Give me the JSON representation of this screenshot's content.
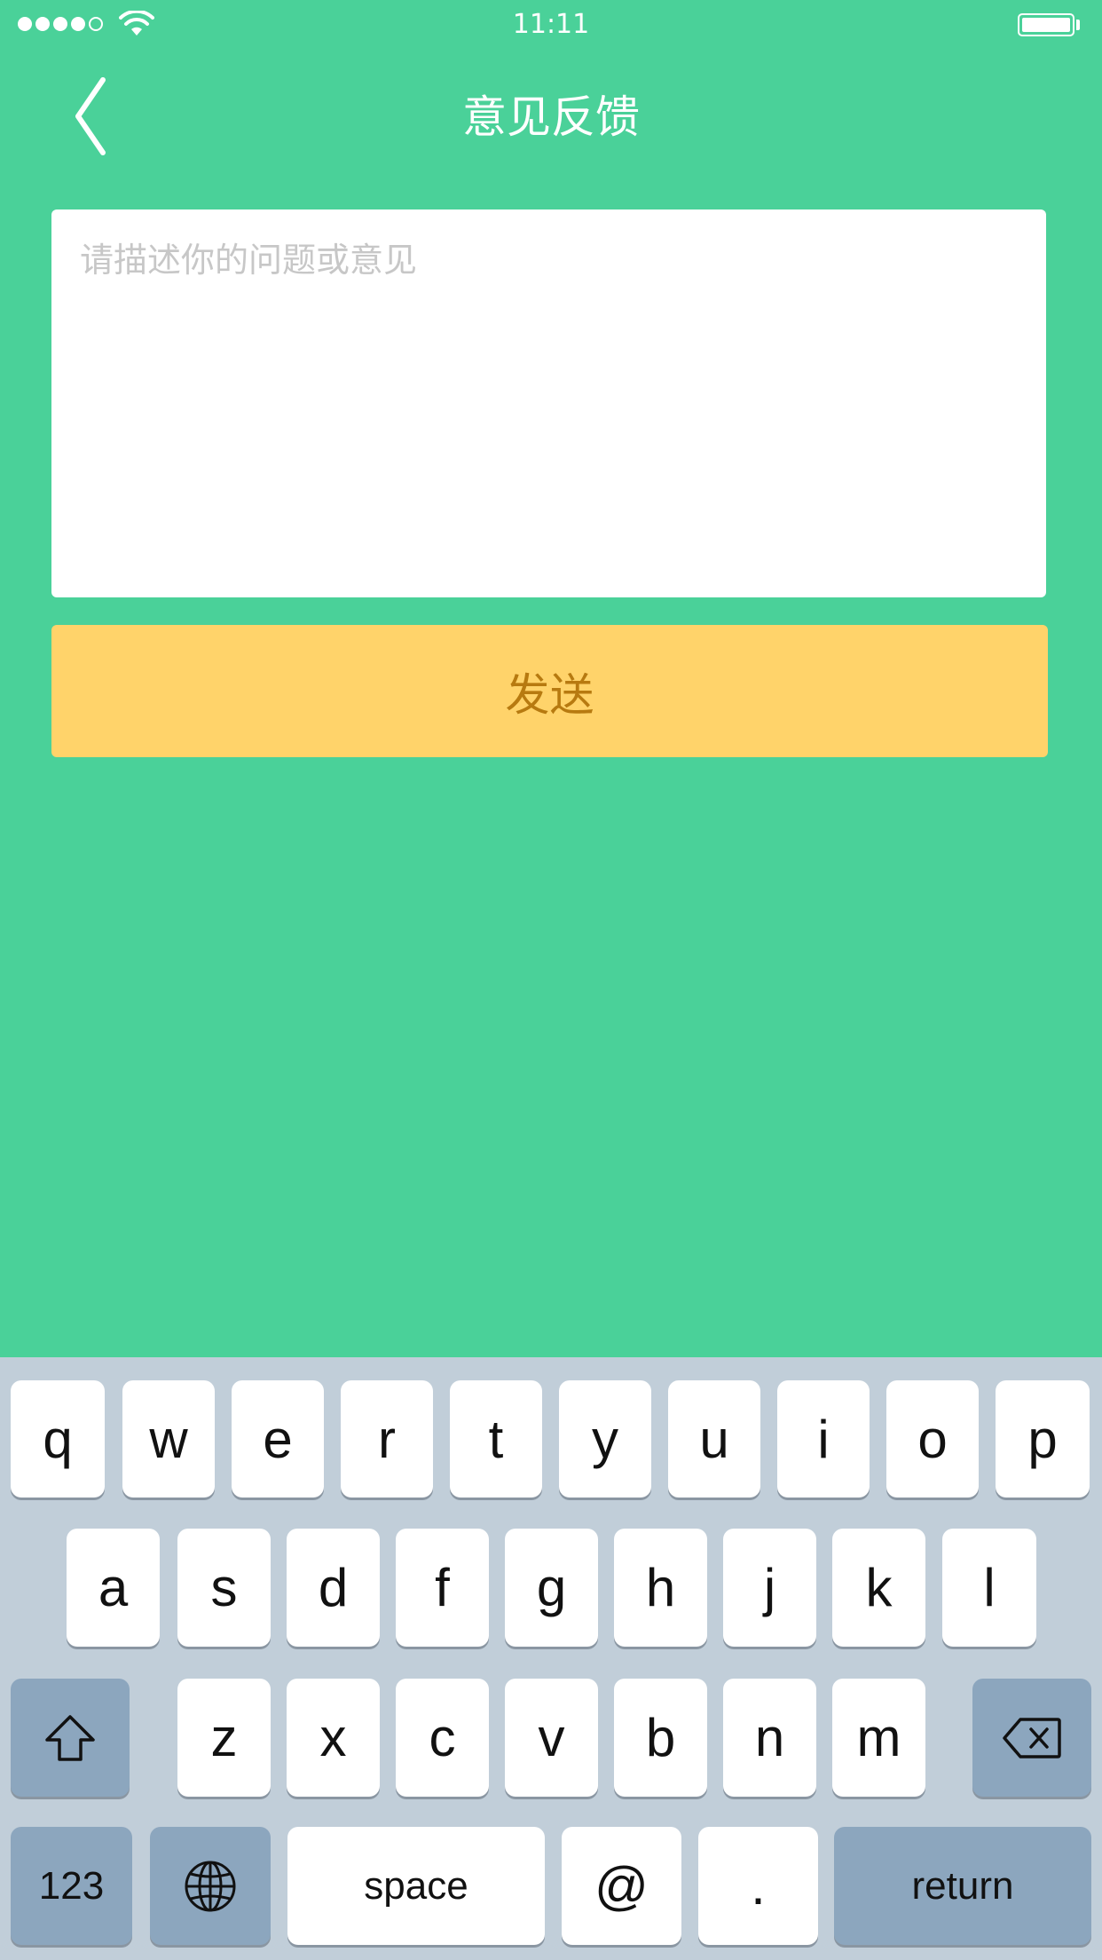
{
  "status_bar": {
    "time": "11:11"
  },
  "nav": {
    "title": "意见反馈"
  },
  "feedback": {
    "placeholder": "请描述你的问题或意见",
    "value": ""
  },
  "send_button": {
    "label": "发送"
  },
  "keyboard": {
    "row1": [
      "q",
      "w",
      "e",
      "r",
      "t",
      "y",
      "u",
      "i",
      "o",
      "p"
    ],
    "row2": [
      "a",
      "s",
      "d",
      "f",
      "g",
      "h",
      "j",
      "k",
      "l"
    ],
    "row3": [
      "z",
      "x",
      "c",
      "v",
      "b",
      "n",
      "m"
    ],
    "numbers_label": "123",
    "space_label": "space",
    "at_label": "@",
    "period_label": ".",
    "return_label": "return"
  },
  "colors": {
    "background": "#4AD199",
    "send_button": "#FFD36A",
    "send_text": "#B77A10",
    "keyboard_bg": "#C1CED9",
    "dark_key": "#8CA6BE"
  },
  "icons": {
    "back": "chevron-left-icon",
    "wifi": "wifi-icon",
    "battery": "battery-icon",
    "shift": "shift-icon",
    "delete": "backspace-icon",
    "globe": "globe-icon"
  }
}
